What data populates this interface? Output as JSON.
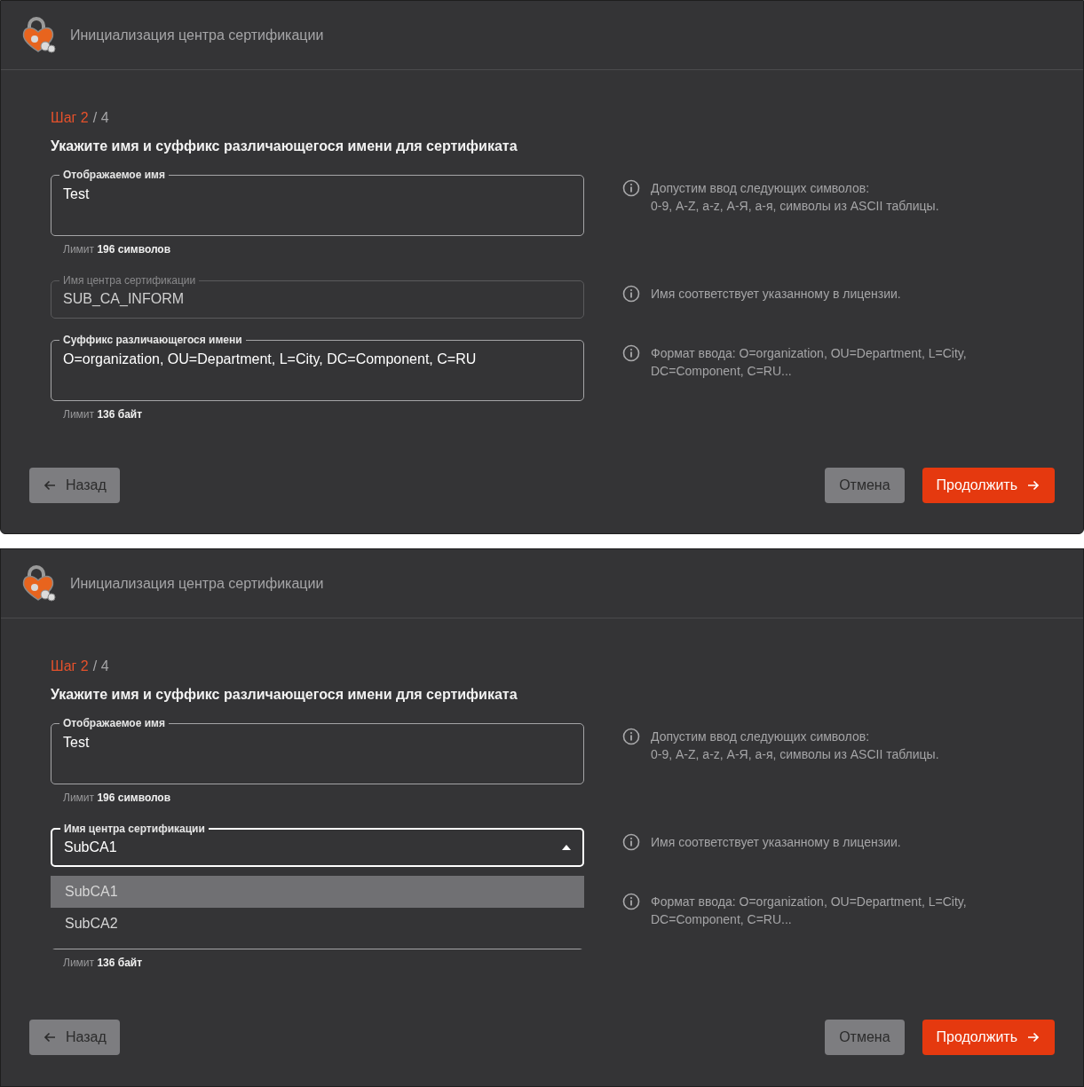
{
  "panels": [
    {
      "title": "Инициализация центра сертификации",
      "step": {
        "current": "Шаг 2",
        "total": "/ 4"
      },
      "heading": "Укажите имя и суффикс различающегося имени для сертификата",
      "fields": [
        {
          "kind": "text",
          "label": "Отображаемое имя",
          "value": "Test",
          "disabled": false,
          "focused": false,
          "tall": true,
          "limit": "Лимит **196 символов**",
          "hint": "Допустим ввод следующих символов:\n0-9, A-Z, a-z, А-Я, а-я, символы из ASCII таблицы."
        },
        {
          "kind": "text",
          "label": "Имя центра сертификации",
          "value": "SUB_CA_INFORM",
          "disabled": true,
          "focused": false,
          "tall": false,
          "hint": "Имя соответствует указанному в лицензии."
        },
        {
          "kind": "text",
          "label": "Суффикс различающегося имени",
          "value": "O=organization, OU=Department, L=City, DC=Component, C=RU",
          "disabled": false,
          "focused": false,
          "tall": true,
          "limit": "Лимит **136 байт**",
          "hint": "Формат ввода: O=organization, OU=Department, L=City,\nDC=Component, C=RU..."
        }
      ],
      "buttons": [
        {
          "kind": "back",
          "label": "Назад"
        },
        {
          "kind": "cancel",
          "label": "Отмена"
        },
        {
          "kind": "next",
          "label": "Продолжить"
        }
      ]
    },
    {
      "title": "Инициализация центра сертификации",
      "step": {
        "current": "Шаг 2",
        "total": "/ 4"
      },
      "heading": "Укажите имя и суффикс различающегося имени для сертификата",
      "fields": [
        {
          "kind": "text",
          "label": "Отображаемое имя",
          "value": "Test",
          "disabled": false,
          "focused": false,
          "tall": true,
          "limit": "Лимит **196 символов**",
          "hint": "Допустим ввод следующих символов:\n0-9, A-Z, a-z, А-Я, а-я, символы из ASCII таблицы."
        },
        {
          "kind": "select",
          "label": "Имя центра сертификации",
          "value": "SubCA1",
          "focused": true,
          "expanded": true,
          "options": [
            {
              "label": "SubCA1",
              "selected": true
            },
            {
              "label": "SubCA2",
              "selected": false
            }
          ],
          "hint": "Имя соответствует указанному в лицензии."
        },
        {
          "kind": "covered",
          "limit": "Лимит **136 байт**",
          "hint": "Формат ввода: O=organization, OU=Department, L=City,\nDC=Component, C=RU..."
        }
      ],
      "buttons": [
        {
          "kind": "back",
          "label": "Назад"
        },
        {
          "kind": "cancel",
          "label": "Отмена"
        },
        {
          "kind": "next",
          "label": "Продолжить"
        }
      ]
    }
  ]
}
